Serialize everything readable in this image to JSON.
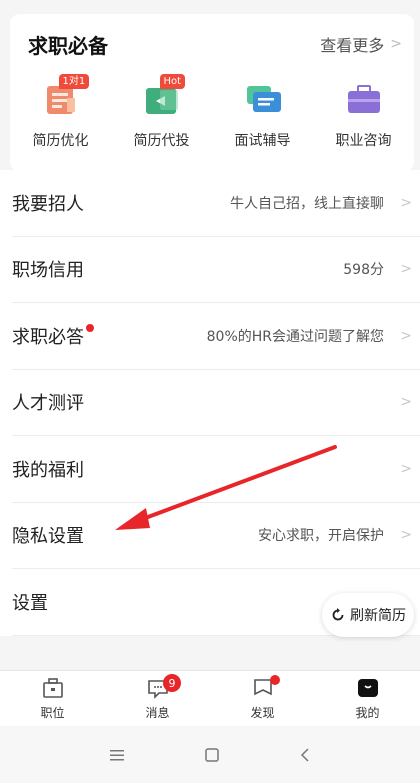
{
  "card": {
    "title": "求职必备",
    "more_label": "查看更多",
    "tools": [
      {
        "label": "简历优化",
        "icon": "resume-optimize-icon",
        "tag": "1对1"
      },
      {
        "label": "简历代投",
        "icon": "resume-deliver-icon",
        "tag": "Hot"
      },
      {
        "label": "面试辅导",
        "icon": "interview-coach-icon",
        "tag": ""
      },
      {
        "label": "职业咨询",
        "icon": "career-consult-icon",
        "tag": ""
      }
    ]
  },
  "menu": [
    {
      "title": "我要招人",
      "value": "牛人自己招，线上直接聊"
    },
    {
      "title": "职场信用",
      "value": "598分"
    },
    {
      "title": "求职必答",
      "value": "80%的HR会通过问题了解您",
      "dot": true
    },
    {
      "title": "人才测评",
      "value": ""
    },
    {
      "title": "我的福利",
      "value": ""
    },
    {
      "title": "隐私设置",
      "value": "安心求职，开启保护"
    },
    {
      "title": "设置",
      "value": ""
    }
  ],
  "refresh_label": "刷新简历",
  "tabbar": [
    {
      "label": "职位",
      "icon": "briefcase-icon"
    },
    {
      "label": "消息",
      "icon": "message-icon",
      "badge": "9"
    },
    {
      "label": "发现",
      "icon": "discover-icon",
      "dot": true
    },
    {
      "label": "我的",
      "icon": "profile-icon",
      "active": true
    }
  ],
  "colors": {
    "accent": "#e8262a",
    "text": "#222222",
    "muted": "#555555"
  }
}
